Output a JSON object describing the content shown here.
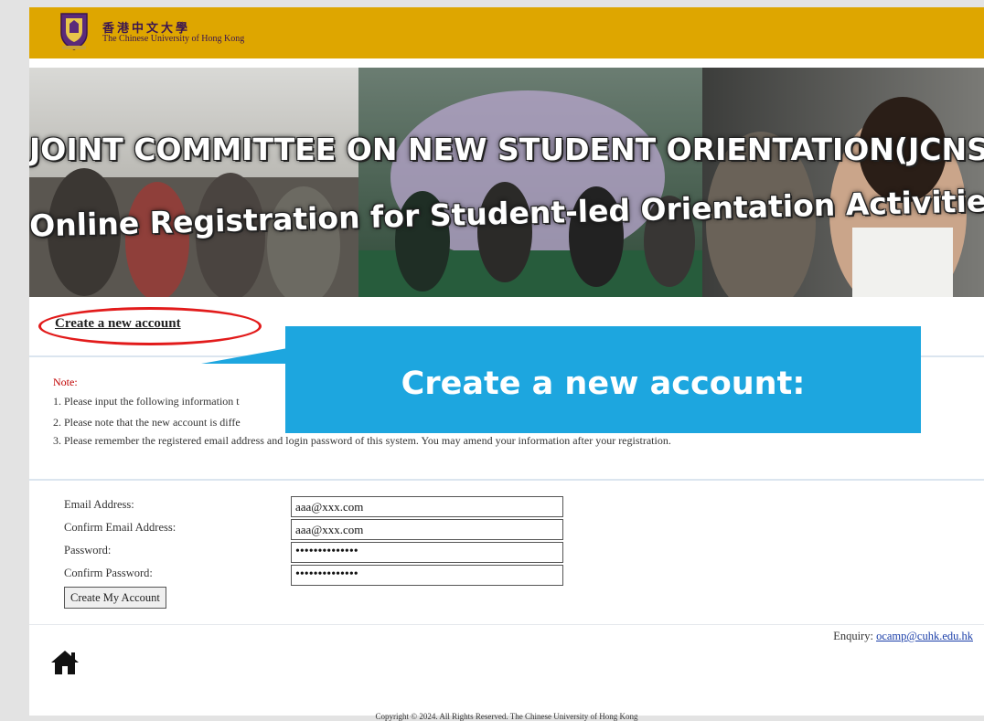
{
  "header": {
    "logo_zh": "香港中文大學",
    "logo_en": "The Chinese University of Hong Kong"
  },
  "banner": {
    "line1": "JOINT COMMITTEE ON NEW STUDENT ORIENTATION(JCNSO)",
    "line2": "Online Registration for Student-led Orientation Activities"
  },
  "create_link": "Create a new account",
  "callout": "Create a new account:",
  "note": {
    "label": "Note:",
    "items": [
      "1. Please input the following information t",
      "2. Please note that the new account is diffe",
      "3. Please remember the registered email address and login password of this system. You may amend your information after your registration."
    ]
  },
  "form": {
    "email_label": "Email Address:",
    "email_value": "aaa@xxx.com",
    "confirm_email_label": "Confirm Email Address:",
    "confirm_email_value": "aaa@xxx.com",
    "password_label": "Password:",
    "password_value": "••••••••••••••",
    "confirm_password_label": "Confirm Password:",
    "confirm_password_value": "••••••••••••••",
    "submit_label": "Create My Account"
  },
  "footer": {
    "enquiry_label": "Enquiry: ",
    "enquiry_email": "ocamp@cuhk.edu.hk",
    "home_icon": "home-icon",
    "copyright": "Copyright © 2024. All Rights Reserved. The Chinese University of Hong Kong"
  },
  "colors": {
    "header": "#dea600",
    "callout": "#1da6df",
    "highlight_oval": "#e21b1b",
    "note_label": "#c00000",
    "link": "#1a3ea8"
  }
}
